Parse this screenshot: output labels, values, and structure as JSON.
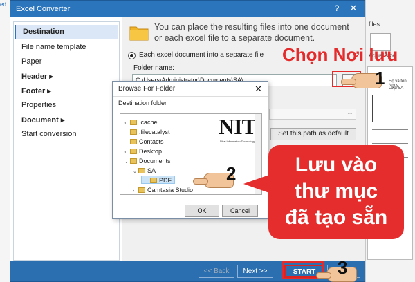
{
  "window": {
    "title": "Excel Converter",
    "help_glyph": "?",
    "close_glyph": "✕"
  },
  "sidebar": {
    "items": [
      {
        "label": "Destination"
      },
      {
        "label": "File name template"
      },
      {
        "label": "Paper"
      },
      {
        "label": "Header ▸"
      },
      {
        "label": "Footer ▸"
      },
      {
        "label": "Properties"
      },
      {
        "label": "Document ▸"
      },
      {
        "label": "Start conversion"
      }
    ]
  },
  "content": {
    "info": "You can place the resulting files into one document or each excel file to a separate document.",
    "radio_label": "Each excel document into a separate file",
    "folder_label": "Folder name:",
    "folder_path": "C:\\Users\\Administrator\\Documents\\SA\\",
    "browse_label": "...",
    "disabled_browse_label": "...",
    "default_btn": "Set this path as default"
  },
  "footer": {
    "back": "<< Back",
    "next": "Next >>",
    "start": "START",
    "cancel": "Cancel"
  },
  "browse_dialog": {
    "title": "Browse For Folder",
    "close_glyph": "✕",
    "destination_label": "Destination folder",
    "tree": [
      {
        "label": ".cache",
        "arrow": "›",
        "indent": 0
      },
      {
        "label": ".filecatalyst",
        "arrow": "",
        "indent": 0
      },
      {
        "label": "Contacts",
        "arrow": "",
        "indent": 0
      },
      {
        "label": "Desktop",
        "arrow": "›",
        "indent": 0
      },
      {
        "label": "Documents",
        "arrow": "⌄",
        "indent": 0
      },
      {
        "label": "SA",
        "arrow": "⌄",
        "indent": 1
      },
      {
        "label": "PDF",
        "arrow": "",
        "indent": 2
      },
      {
        "label": "Camtasia Studio",
        "arrow": "›",
        "indent": 1
      }
    ],
    "selected_item": "PDF",
    "logo_text": "NIT",
    "logo_subtext": "Nhat Information Technology",
    "ok": "OK",
    "cancel": "Cancel"
  },
  "annotations": {
    "choose_location": "Chọn Nơi lưu",
    "step1": "1",
    "step2": "2",
    "step3": "3",
    "callout_lines": [
      "Lưu vào",
      "thư mục",
      "đã tạo sẵn"
    ]
  },
  "background_app": {
    "tab_label": "files",
    "size_label": "Actual size",
    "doc_text_1": "Họ và tên: Nguy",
    "doc_text_2": "Lớp: 5A",
    "left_text": "ed"
  },
  "colors": {
    "titlebar": "#2b75bd",
    "footer": "#2b6fb0",
    "annotation_red": "#e42a2a"
  }
}
